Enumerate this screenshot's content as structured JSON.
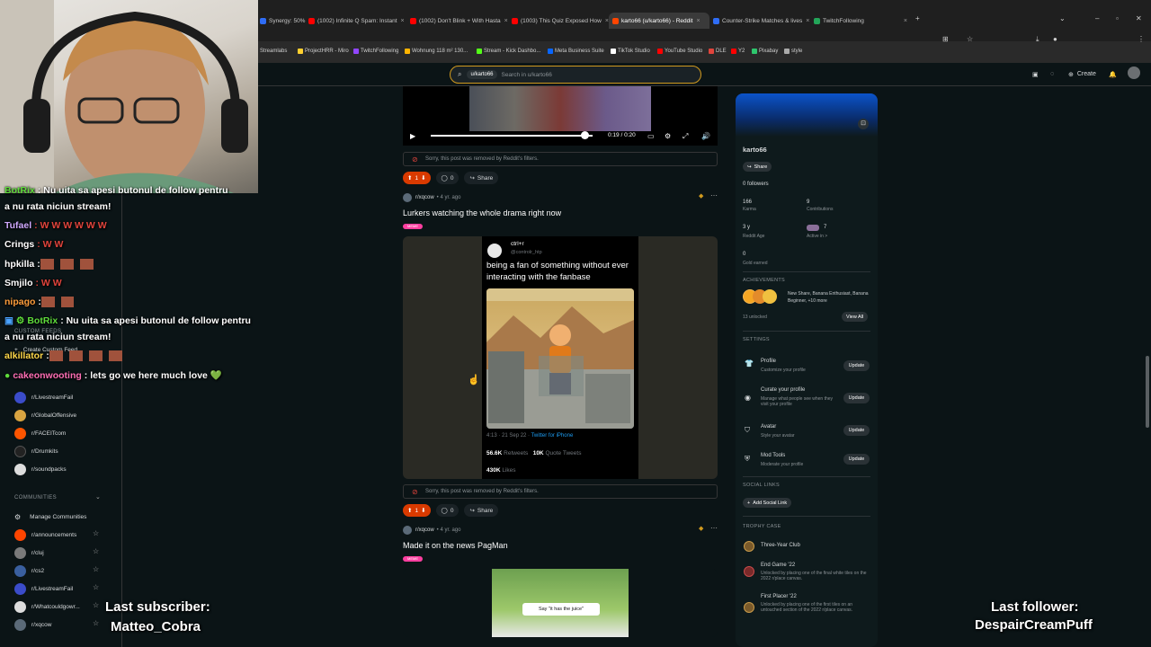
{
  "browser": {
    "tabs": [
      {
        "label": "Synergy: 50%",
        "color": "#2f6df6"
      },
      {
        "label": "(1002) Infinite Q Spam: Instant",
        "color": "#ff0000"
      },
      {
        "label": "(1002) Don't Blink + With Hasta",
        "color": "#ff0000"
      },
      {
        "label": "(1003) This Quiz Exposed How",
        "color": "#ff0000"
      },
      {
        "label": "karto66 (u/karto66) - Reddit",
        "color": "#ff4500"
      },
      {
        "label": "Counter-Strike Matches & lives",
        "color": "#2f6df6"
      },
      {
        "label": "TwitchFollowing",
        "color": "#23a559"
      }
    ],
    "bookmarks": [
      {
        "label": "Streamlabs",
        "color": "#80f5d2"
      },
      {
        "label": "ProjectHRR - Miro",
        "color": "#ffd02f"
      },
      {
        "label": "TwitchFollowing",
        "color": "#9146ff"
      },
      {
        "label": "Wohnung 118 m² 130...",
        "color": "#ffb400"
      },
      {
        "label": "Stream - Kick Dashbo...",
        "color": "#53fc18"
      },
      {
        "label": "Meta Business Suite",
        "color": "#0866ff"
      },
      {
        "label": "TikTok Studio",
        "color": "#ffffff"
      },
      {
        "label": "YouTube Studio",
        "color": "#ff0000"
      },
      {
        "label": "DLE",
        "color": "#e0443c"
      },
      {
        "label": "Y2",
        "color": "#ff0000"
      },
      {
        "label": "Pixabay",
        "color": "#2ec66d"
      },
      {
        "label": "style",
        "color": "#aaaaaa"
      }
    ]
  },
  "reddit_header": {
    "search_chip": "u/karto66",
    "search_placeholder": "Search in u/karto66",
    "create_label": "Create"
  },
  "left_sidebar": {
    "custom_feeds_header": "CUSTOM FEEDS",
    "create_custom_feed": "Create Custom Feed",
    "recent_items": [
      {
        "label": "r/LivestreamFail",
        "color": "#3b4cca"
      },
      {
        "label": "r/GlobalOffensive",
        "color": "#d9a441"
      },
      {
        "label": "r/FACEITcom",
        "color": "#ff5500"
      },
      {
        "label": "r/Drumkits",
        "color": "#222222"
      },
      {
        "label": "r/soundpacks",
        "color": "#dddddd"
      }
    ],
    "communities_header": "COMMUNITIES",
    "manage_communities": "Manage Communities",
    "communities": [
      {
        "label": "r/announcements",
        "color": "#ff4500"
      },
      {
        "label": "r/cluj",
        "color": "#7a7a7a"
      },
      {
        "label": "r/cs2",
        "color": "#3a5f9f"
      },
      {
        "label": "r/LivestreamFail",
        "color": "#3b4cca"
      },
      {
        "label": "r/Whatcouldgowr...",
        "color": "#dddddd"
      },
      {
        "label": "r/xqcow",
        "color": "#5b6a78"
      }
    ]
  },
  "video_post": {
    "time": "0:19 / 0:20",
    "progress": 0.95,
    "removed_notice": "Sorry, this post was removed by Reddit's filters.",
    "votes": "1",
    "comments": "0",
    "share": "Share"
  },
  "post1": {
    "subreddit": "r/xqcow",
    "age": "• 4 yr. ago",
    "title": "Lurkers watching the whole drama right now",
    "flair": "MEME",
    "tweet": {
      "name": "ctrl+r",
      "handle": "@controlr_htp",
      "text": "being a fan of something without ever interacting with the fanbase",
      "timestamp": "4:13 · 21 Sep 22 · ",
      "source": "Twitter for iPhone",
      "retweets_num": "56.6K",
      "retweets_label": "Retweets",
      "quotes_num": "10K",
      "quotes_label": "Quote Tweets",
      "likes_num": "430K",
      "likes_label": "Likes"
    },
    "removed_notice": "Sorry, this post was removed by Reddit's filters.",
    "votes": "1",
    "comments": "0",
    "share": "Share"
  },
  "post2": {
    "subreddit": "r/xqcow",
    "age": "• 4 yr. ago",
    "title": "Made it on the news PagMan",
    "flair": "MEME",
    "embedded_caption": "Say \"it has the juice\""
  },
  "profile": {
    "username": "karto66",
    "share": "Share",
    "followers": "0 followers",
    "karma_value": "166",
    "karma_label": "Karma",
    "contributions_value": "9",
    "contributions_label": "Contributions",
    "age_value": "3 y",
    "age_label": "Reddit Age",
    "active_value": "7",
    "active_label": "Active in >",
    "gold_value": "0",
    "gold_label": "Gold earned",
    "achievements_header": "ACHIEVEMENTS",
    "achievements_text": "New Share, Banana Enthusiast, Banana Beginner, +10 more",
    "unlocked": "13 unlocked",
    "view_all": "View All",
    "settings_header": "SETTINGS",
    "settings": [
      {
        "title": "Profile",
        "sub": "Customize your profile",
        "button": "Update"
      },
      {
        "title": "Curate your profile",
        "sub": "Manage what people see when they visit your profile",
        "button": "Update"
      },
      {
        "title": "Avatar",
        "sub": "Style your avatar",
        "button": "Update"
      },
      {
        "title": "Mod Tools",
        "sub": "Moderate your profile",
        "button": "Update"
      }
    ],
    "social_links_header": "SOCIAL LINKS",
    "add_social_link": "Add Social Link",
    "trophy_header": "TROPHY CASE",
    "trophies": [
      {
        "title": "Three-Year Club",
        "sub": ""
      },
      {
        "title": "End Game '22",
        "sub": "Unlocked by placing one of the final white tiles on the 2022 r/place canvas."
      },
      {
        "title": "First Placer '22",
        "sub": "Unlocked by placing one of the first tiles on an untouched section of the 2022 r/place canvas."
      }
    ]
  },
  "stream_overlay": {
    "chat": [
      {
        "user": "BotRix",
        "user_color": "#5fdc3c",
        "msg": ": Nu uita sa apesi butonul de follow pentru"
      },
      {
        "user": "",
        "user_color": "#ffffff",
        "msg": "a nu rata niciun stream!"
      },
      {
        "user": "Tufael",
        "user_color": "#cfa9ff",
        "msg": ": W W W W W W"
      },
      {
        "user": "Crings",
        "user_color": "#ffffff",
        "msg": ": W W"
      },
      {
        "user": "hpkilla",
        "user_color": "#ffffff",
        "msg": ":"
      },
      {
        "user": "Smjilo",
        "user_color": "#ffffff",
        "msg": ": W W"
      },
      {
        "user": "nipago",
        "user_color": "#ff9d3c",
        "msg": ":"
      },
      {
        "user": "BotRix",
        "user_color": "#5fdc3c",
        "msg": ": Nu uita sa apesi butonul de follow pentru"
      },
      {
        "user": "",
        "user_color": "#ffffff",
        "msg": "a nu rata niciun stream!"
      },
      {
        "user": "alkillator",
        "user_color": "#ffd84a",
        "msg": ":"
      },
      {
        "user": "cakeonwooting",
        "user_color": "#ff6fb5",
        "msg": ": lets go we here much love 💚"
      }
    ],
    "last_subscriber_label": "Last subscriber:",
    "last_subscriber_name": "Matteo_Cobra",
    "last_follower_label": "Last follower:",
    "last_follower_name": "DespairCreamPuff"
  }
}
